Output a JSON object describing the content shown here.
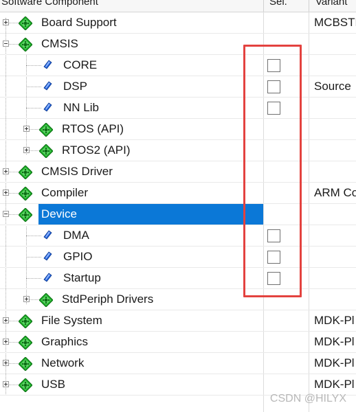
{
  "header": {
    "component": "Software Component",
    "sel": "Sel.",
    "variant": "Variant"
  },
  "rows": [
    {
      "label": "Board Support",
      "variant": "MCBSTM"
    },
    {
      "label": "CMSIS",
      "variant": ""
    },
    {
      "label": "CORE",
      "variant": ""
    },
    {
      "label": "DSP",
      "variant": "Source"
    },
    {
      "label": "NN Lib",
      "variant": ""
    },
    {
      "label": "RTOS (API)",
      "variant": ""
    },
    {
      "label": "RTOS2 (API)",
      "variant": ""
    },
    {
      "label": "CMSIS Driver",
      "variant": ""
    },
    {
      "label": "Compiler",
      "variant": "ARM Co"
    },
    {
      "label": "Device",
      "variant": ""
    },
    {
      "label": "DMA",
      "variant": ""
    },
    {
      "label": "GPIO",
      "variant": ""
    },
    {
      "label": "Startup",
      "variant": ""
    },
    {
      "label": "StdPeriph Drivers",
      "variant": ""
    },
    {
      "label": "File System",
      "variant": "MDK-Pl"
    },
    {
      "label": "Graphics",
      "variant": "MDK-Pl"
    },
    {
      "label": "Network",
      "variant": "MDK-Pl"
    },
    {
      "label": "USB",
      "variant": "MDK-Pl"
    }
  ],
  "watermark": "CSDN @HILYX",
  "colors": {
    "selection": "#0b78d7",
    "highlight_box": "#e3423f",
    "gem_green": "#1fae2a",
    "leaf_blue": "#1f5fd6"
  },
  "icons": {
    "group": "green-diamond-gem-icon",
    "component": "blue-leaf-icon"
  }
}
